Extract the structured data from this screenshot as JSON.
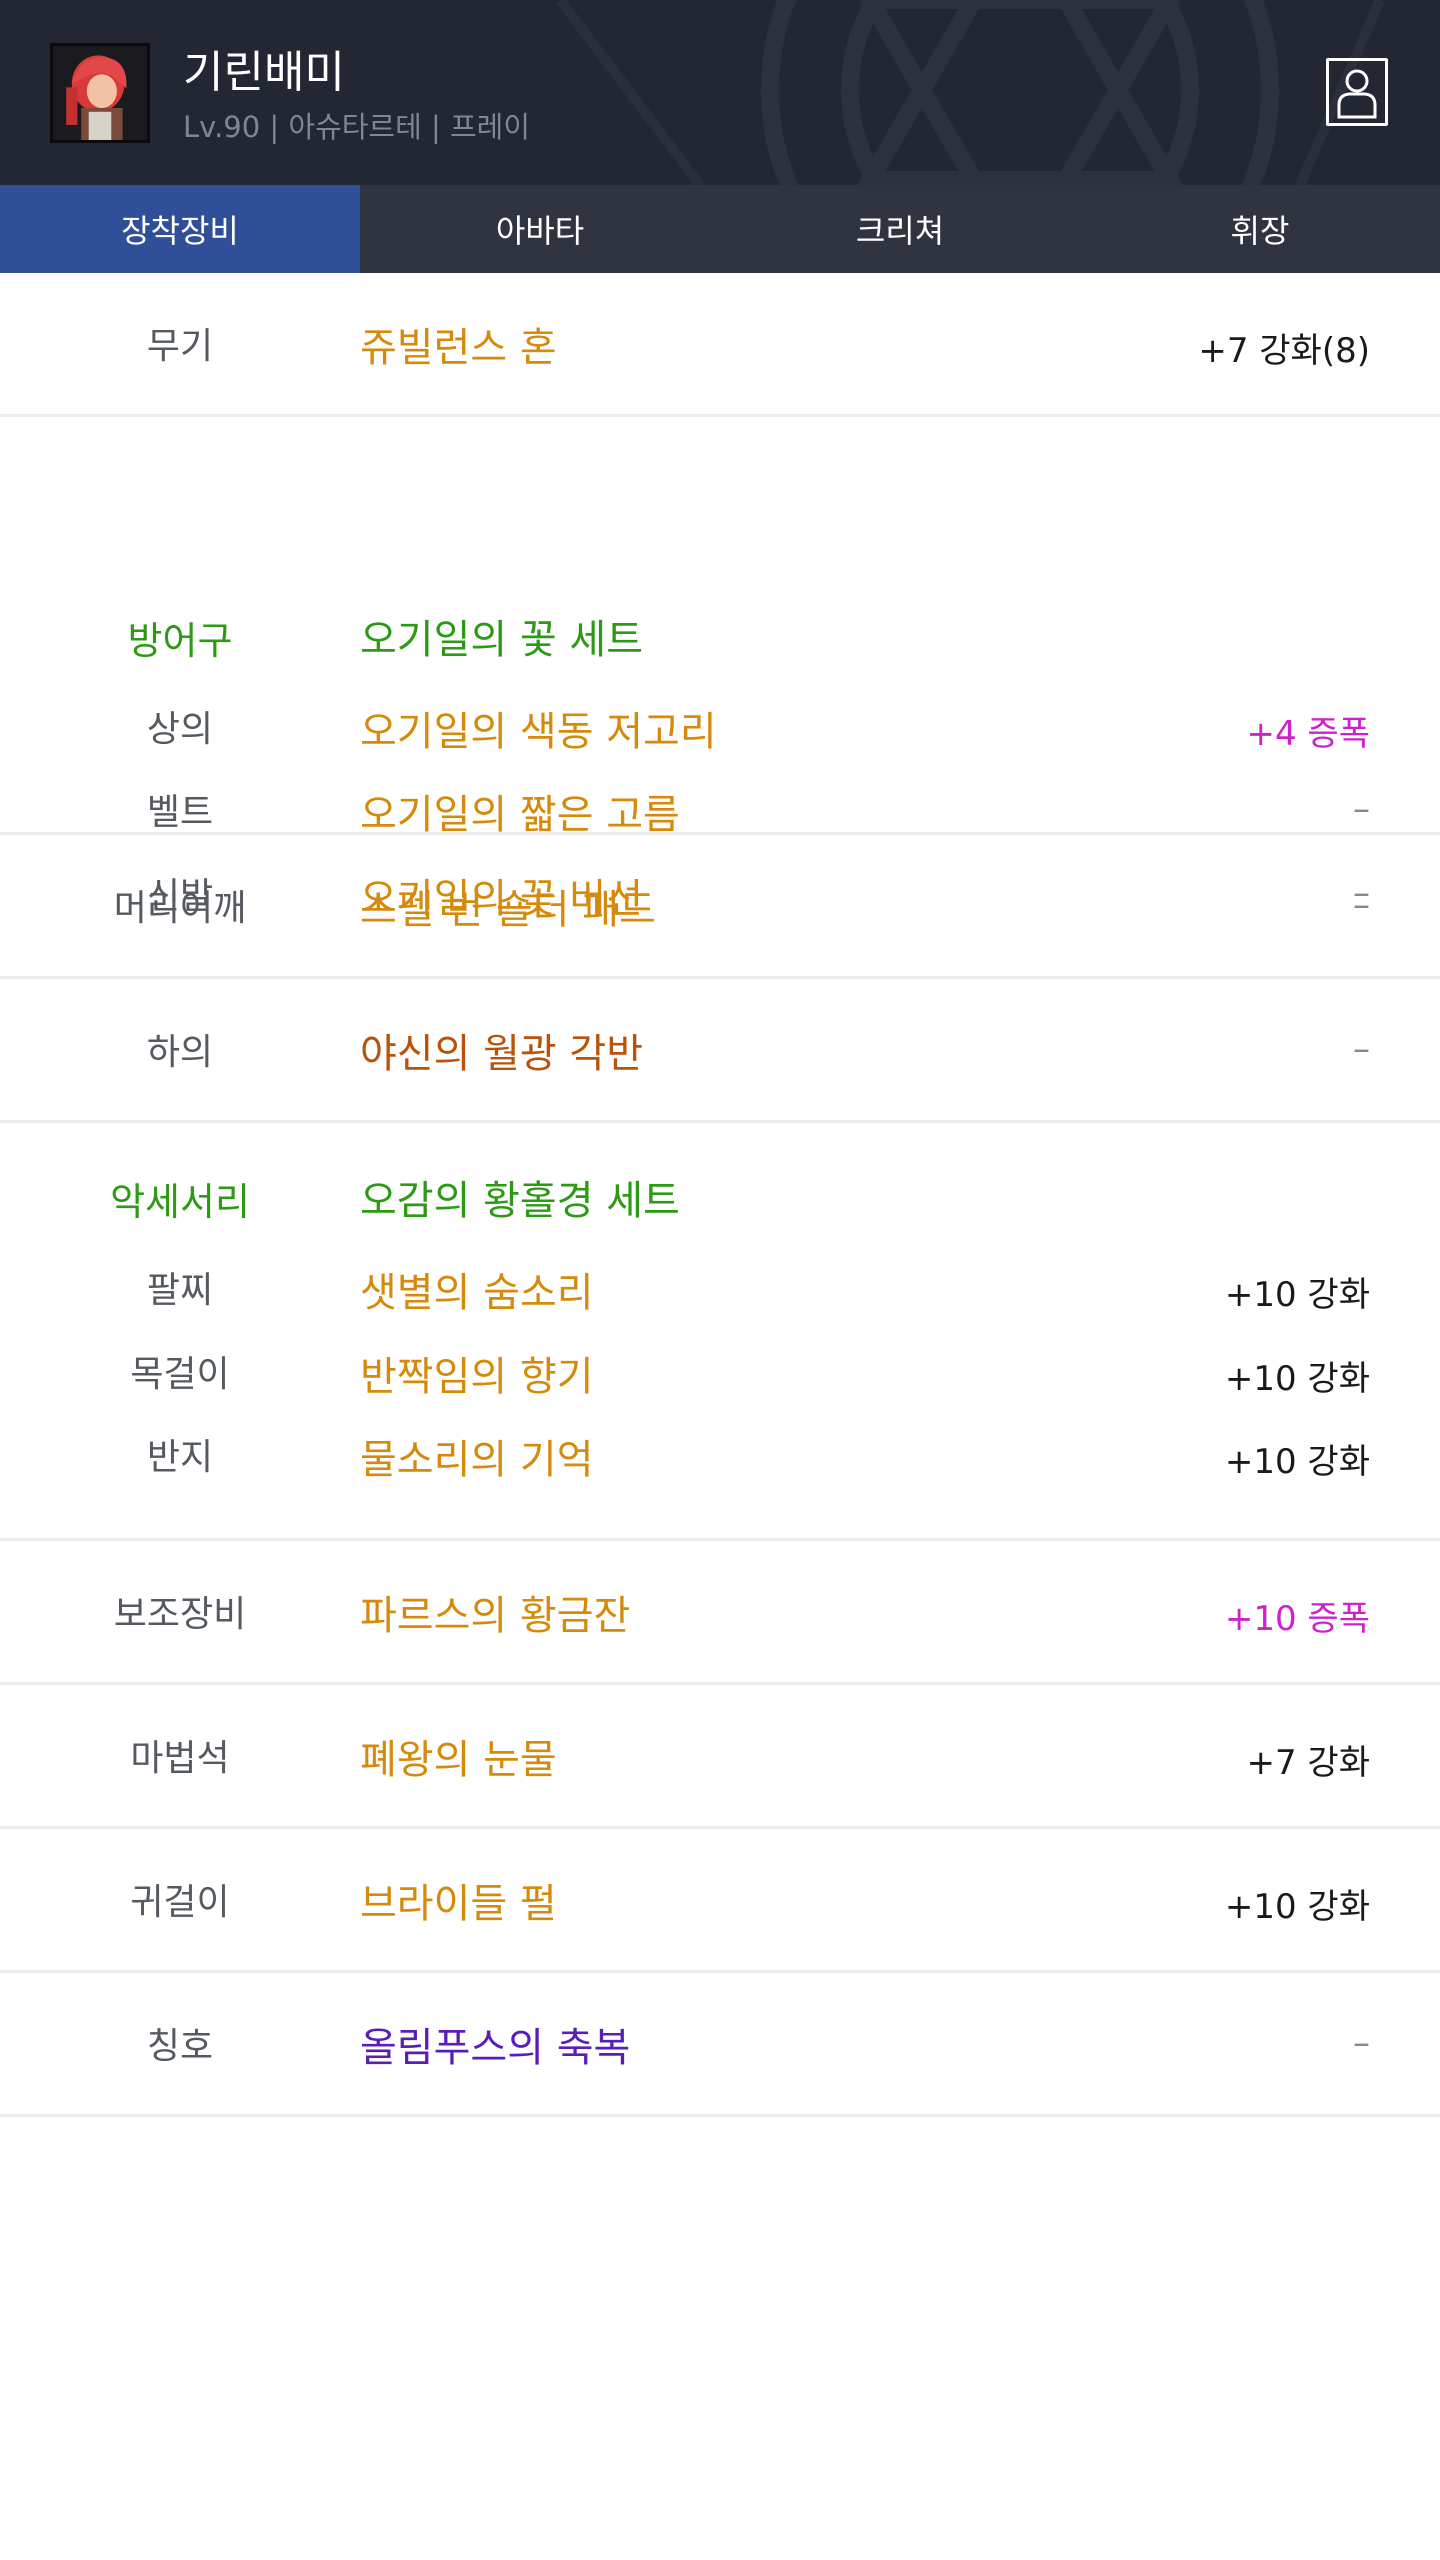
{
  "colors": {
    "header_bg": "#232733",
    "tab_bar_bg": "#2f3440",
    "tab_active_bg": "#2f4f98",
    "set_green": "#2d9a16",
    "epic_orange": "#d58a0c",
    "legendary_brown": "#b9530c",
    "unique_purple": "#5a1db8",
    "amplify_magenta": "#cc22cc"
  },
  "header": {
    "character_name": "기린배미",
    "character_info": "Lv.90 | 아슈타르테 | 프레이",
    "avatar_icon": "character-portrait",
    "profile_icon": "person-icon"
  },
  "tabs": [
    {
      "label": "장착장비",
      "active": true
    },
    {
      "label": "아바타",
      "active": false
    },
    {
      "label": "크리쳐",
      "active": false
    },
    {
      "label": "휘장",
      "active": false
    }
  ],
  "equipment": {
    "weapon": {
      "slot": "무기",
      "name": "쥬빌런스 혼",
      "value": "+7 강화(8)"
    },
    "armor": {
      "group": "방어구",
      "set_name": "오기일의 꽃 세트",
      "items": [
        {
          "slot": "상의",
          "name": "오기일의 색동 저고리",
          "value": "+4 증폭"
        },
        {
          "slot": "벨트",
          "name": "오기일의 짧은 고름",
          "value": "–"
        },
        {
          "slot": "신발",
          "name": "오기일의 꽃 버선",
          "value": "–"
        }
      ]
    },
    "shoulder": {
      "slot": "머리어깨",
      "name": "스펠 번 숄더 패드",
      "value": "–"
    },
    "pants": {
      "slot": "하의",
      "name": "야신의 월광 각반",
      "value": "–"
    },
    "accessory": {
      "group": "악세서리",
      "set_name": "오감의 황홀경 세트",
      "items": [
        {
          "slot": "팔찌",
          "name": "샛별의 숨소리",
          "value": "+10 강화"
        },
        {
          "slot": "목걸이",
          "name": "반짝임의 향기",
          "value": "+10 강화"
        },
        {
          "slot": "반지",
          "name": "물소리의 기억",
          "value": "+10 강화"
        }
      ]
    },
    "sub_equipment": {
      "slot": "보조장비",
      "name": "파르스의 황금잔",
      "value": "+10 증폭"
    },
    "magic_stone": {
      "slot": "마법석",
      "name": "폐왕의 눈물",
      "value": "+7 강화"
    },
    "earring": {
      "slot": "귀걸이",
      "name": "브라이들 펄",
      "value": "+10 강화"
    },
    "title": {
      "slot": "칭호",
      "name": "올림푸스의 축복",
      "value": "–"
    }
  }
}
